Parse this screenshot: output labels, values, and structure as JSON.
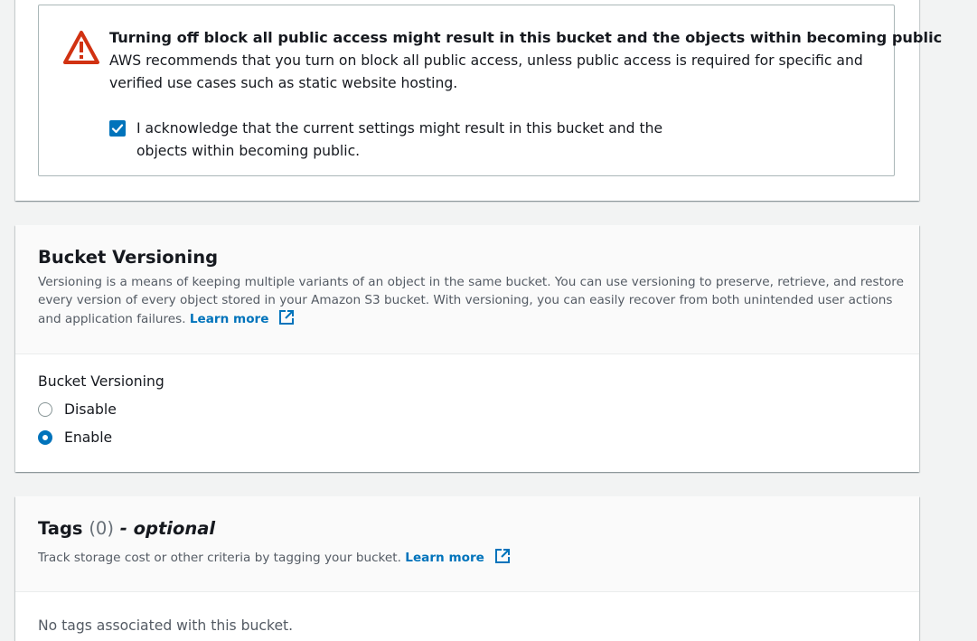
{
  "warning": {
    "icon": "warning-triangle-icon",
    "title": "Turning off block all public access might result in this bucket and the objects within becoming public",
    "body": "AWS recommends that you turn on block all public access, unless public access is required for specific and verified use cases such as static website hosting.",
    "acknowledge_checked": true,
    "acknowledge_label": "I acknowledge that the current settings might result in this bucket and the objects within becoming public."
  },
  "versioning": {
    "title": "Bucket Versioning",
    "description": "Versioning is a means of keeping multiple variants of an object in the same bucket. You can use versioning to preserve, retrieve, and restore every version of every object stored in your Amazon S3 bucket. With versioning, you can easily recover from both unintended user actions and application failures.",
    "learn_more": "Learn more",
    "field_label": "Bucket Versioning",
    "options": [
      {
        "label": "Disable",
        "selected": false
      },
      {
        "label": "Enable",
        "selected": true
      }
    ]
  },
  "tags": {
    "title": "Tags",
    "count": "(0)",
    "optional": "- optional",
    "description": "Track storage cost or other criteria by tagging your bucket.",
    "learn_more": "Learn more",
    "empty_text": "No tags associated with this bucket."
  },
  "colors": {
    "accent": "#0073bb",
    "warning": "#d13212",
    "background": "#f2f3f3"
  }
}
